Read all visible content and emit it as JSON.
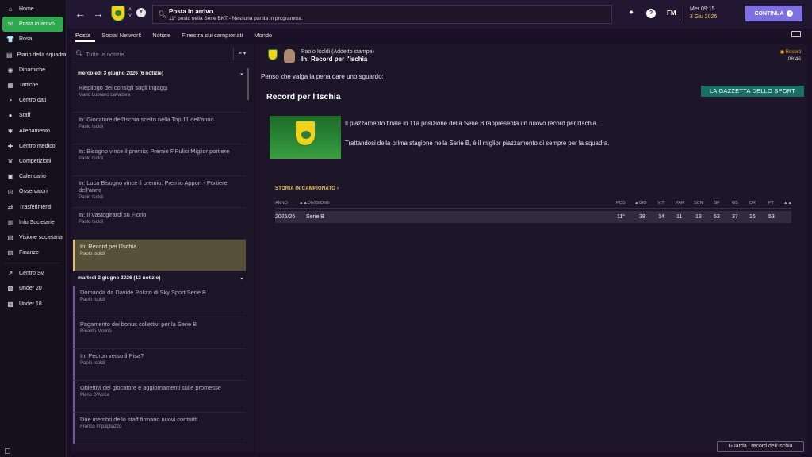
{
  "sidebar": {
    "items": [
      {
        "label": "Home",
        "icon": "home-icon",
        "glyph": "⌂"
      },
      {
        "label": "Posta in arrivo",
        "icon": "inbox-icon",
        "glyph": "✉",
        "active": true
      },
      {
        "label": "Rosa",
        "icon": "shirt-icon",
        "glyph": "👕"
      },
      {
        "label": "Piano della squadra",
        "icon": "plan-icon",
        "glyph": "▤"
      },
      {
        "label": "Dinamiche",
        "icon": "chat-icon",
        "glyph": "◉"
      },
      {
        "label": "Tattiche",
        "icon": "tactics-icon",
        "glyph": "▦"
      },
      {
        "label": "Centro dati",
        "icon": "data-icon",
        "glyph": "◔"
      },
      {
        "label": "Staff",
        "icon": "staff-icon",
        "glyph": "●"
      },
      {
        "label": "Allenamento",
        "icon": "training-icon",
        "glyph": "✱"
      },
      {
        "label": "Centro medico",
        "icon": "medical-icon",
        "glyph": "✚"
      },
      {
        "label": "Competizioni",
        "icon": "trophy-icon",
        "glyph": "♛"
      },
      {
        "label": "Calendario",
        "icon": "calendar-icon",
        "glyph": "▣"
      },
      {
        "label": "Osservatori",
        "icon": "scouting-icon",
        "glyph": "◎"
      },
      {
        "label": "Trasferimenti",
        "icon": "transfers-icon",
        "glyph": "⇄"
      },
      {
        "label": "Info Societarie",
        "icon": "club-info-icon",
        "glyph": "▥"
      },
      {
        "label": "Visione societaria",
        "icon": "vision-icon",
        "glyph": "▧"
      },
      {
        "label": "Finanze",
        "icon": "finance-icon",
        "glyph": "▨"
      }
    ],
    "bottom_items": [
      {
        "label": "Centro Sv.",
        "icon": "development-icon",
        "glyph": "↗"
      },
      {
        "label": "Under 20",
        "icon": "under20-icon",
        "glyph": "▩"
      },
      {
        "label": "Under 18",
        "icon": "under18-icon",
        "glyph": "▩"
      }
    ]
  },
  "topbar": {
    "title": "Posta in arrivo",
    "subtitle": "11° posto nella Serie BKT - Nessuna partita in programma.",
    "logo": "FM",
    "time": "Mer 09:15",
    "date": "3 Giu 2026",
    "continue_label": "CONTINUA"
  },
  "tabs": [
    "Posta",
    "Social Network",
    "Notizie",
    "Finestra sui campionati",
    "Mondo"
  ],
  "list": {
    "search_placeholder": "Tutte le notizie",
    "filter_label": "≡ ▾",
    "groups": [
      {
        "title": "mercoledì 3 giugno 2026 (6 notizie)"
      },
      {
        "title": "martedì 2 giugno 2026 (13 notizie)"
      }
    ],
    "messages_day1": [
      {
        "subject": "Riepilogo dei consigli sugli ingaggi",
        "from": "Mario Lubrano Lavadera"
      },
      {
        "subject": "In: Giocatore dell'Ischia scelto nella Top 11 dell'anno",
        "from": "Paolo Isoldi"
      },
      {
        "subject": "In: Bisogno vince il premio: Premio F.Pulici Miglior portiere",
        "from": "Paolo Isoldi"
      },
      {
        "subject": "In: Luca Bisogno vince il premio: Premio Apport - Portiere dell'anno",
        "from": "Paolo Isoldi"
      },
      {
        "subject": "In: Il Vastogirardi su Florio",
        "from": "Paolo Isoldi"
      },
      {
        "subject": "In: Record per l'Ischia",
        "from": "Paolo Isoldi"
      }
    ],
    "messages_day2": [
      {
        "subject": "Domanda da Davide Polizzi di Sky Sport Serie B",
        "from": "Paolo Isoldi"
      },
      {
        "subject": "Pagamento dei bonus collettivi per la Serie B",
        "from": "Rinaldo Molino"
      },
      {
        "subject": "In: Pedron verso il Pisa?",
        "from": "Paolo Isoldi"
      },
      {
        "subject": "Obiettivi del giocatore e aggiornamenti sulle promesse",
        "from": "Mario D'Apice"
      },
      {
        "subject": "Due membri dello staff firmano nuovi contratti",
        "from": "Franco Impagliazzo"
      }
    ]
  },
  "detail": {
    "sender": "Paolo Isoldi  (Addetto stampa)",
    "subject": "In: Record per l'Ischia",
    "source": "Record",
    "time": "08:46",
    "intro": "Penso che valga la pena dare uno sguardo:",
    "newspaper": "LA GAZZETTA DELLO SPORT",
    "article_title": "Record per l'Ischia",
    "paragraph1": "Il piazzamento finale in 11a posizione della Serie B rappresenta un nuovo record per l'Ischia.",
    "paragraph2": "Trattandosi della prima stagione nella Serie B, è il miglior piazzamento di sempre per la squadra.",
    "history_link": "STORIA IN CAMPIONATO",
    "table": {
      "headers": [
        "ANNO",
        "▲▲DIVISIONE",
        "POS",
        "▲GIO",
        "VIT",
        "PAR",
        "SCN",
        "GF",
        "GS",
        "DR",
        "PT",
        "▲▲"
      ],
      "row": [
        "2025/26",
        "Serie B",
        "11°",
        "38",
        "14",
        "11",
        "13",
        "53",
        "37",
        "16",
        "53"
      ]
    },
    "records_button": "Guarda i record dell'Ischia"
  },
  "colors": {
    "accent_green": "#2fa84f",
    "continue_button": "#7d70e0",
    "gazzetta_teal": "#1b6e66",
    "history_link": "#f0c850"
  }
}
